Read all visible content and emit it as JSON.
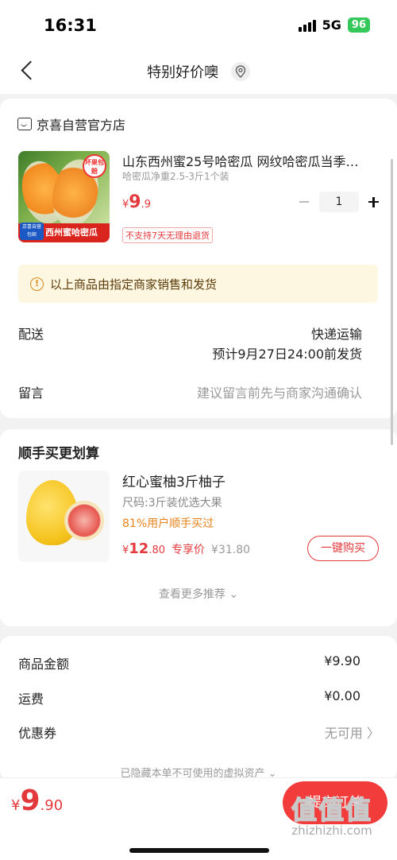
{
  "status_bar": {
    "time": "16:31",
    "network": "5G",
    "battery": "96"
  },
  "nav": {
    "title": "特别好价噢"
  },
  "shop": {
    "name": "京喜自营官方店"
  },
  "product": {
    "title": "山东西州蜜25号哈密瓜 网纹哈密瓜当季…",
    "spec": "哈密瓜净重2.5-3斤1个装",
    "price_symbol": "¥",
    "price_int": "9",
    "price_dec": ".9",
    "quantity": "1",
    "no_return_label": "不支持7天无理由退货",
    "image_badge": "坏果包赔",
    "image_banner": "西州蜜哈密瓜",
    "image_mini": "京喜自营 包邮"
  },
  "notice": {
    "text": "以上商品由指定商家销售和发货"
  },
  "delivery": {
    "label": "配送",
    "method": "快递运输",
    "eta": "预计9月27日24:00前发货"
  },
  "remark": {
    "label": "留言",
    "placeholder": "建议留言前先与商家沟通确认"
  },
  "recommend": {
    "title": "顺手买更划算",
    "item": {
      "name": "红心蜜柚3斤柚子",
      "spec": "尺码:3斤装优选大果",
      "buy_rate": "81%用户顺手买过",
      "price_symbol": "¥",
      "price_int": "12",
      "price_dec": ".80",
      "price_tag": "专享价",
      "old_price": "¥31.80",
      "button": "一键购买"
    },
    "more": "查看更多推荐 ⌄"
  },
  "summary": {
    "goods_label": "商品金额",
    "goods_value": "¥9.90",
    "shipping_label": "运费",
    "shipping_value": "¥0.00",
    "coupon_label": "优惠券",
    "coupon_value": "无可用 〉",
    "hidden_note": "已隐藏本单不可使用的虚拟资产 ⌄"
  },
  "bottom": {
    "total_symbol": "¥",
    "total_int": "9",
    "total_dec": ".90",
    "submit": "提交订单"
  },
  "watermark": {
    "big": "值值值",
    "small": "zhizhizhi.com"
  },
  "colors": {
    "accent": "#e4393c",
    "notice_bg": "#fdf6e0",
    "buy_rate": "#e8811a"
  }
}
